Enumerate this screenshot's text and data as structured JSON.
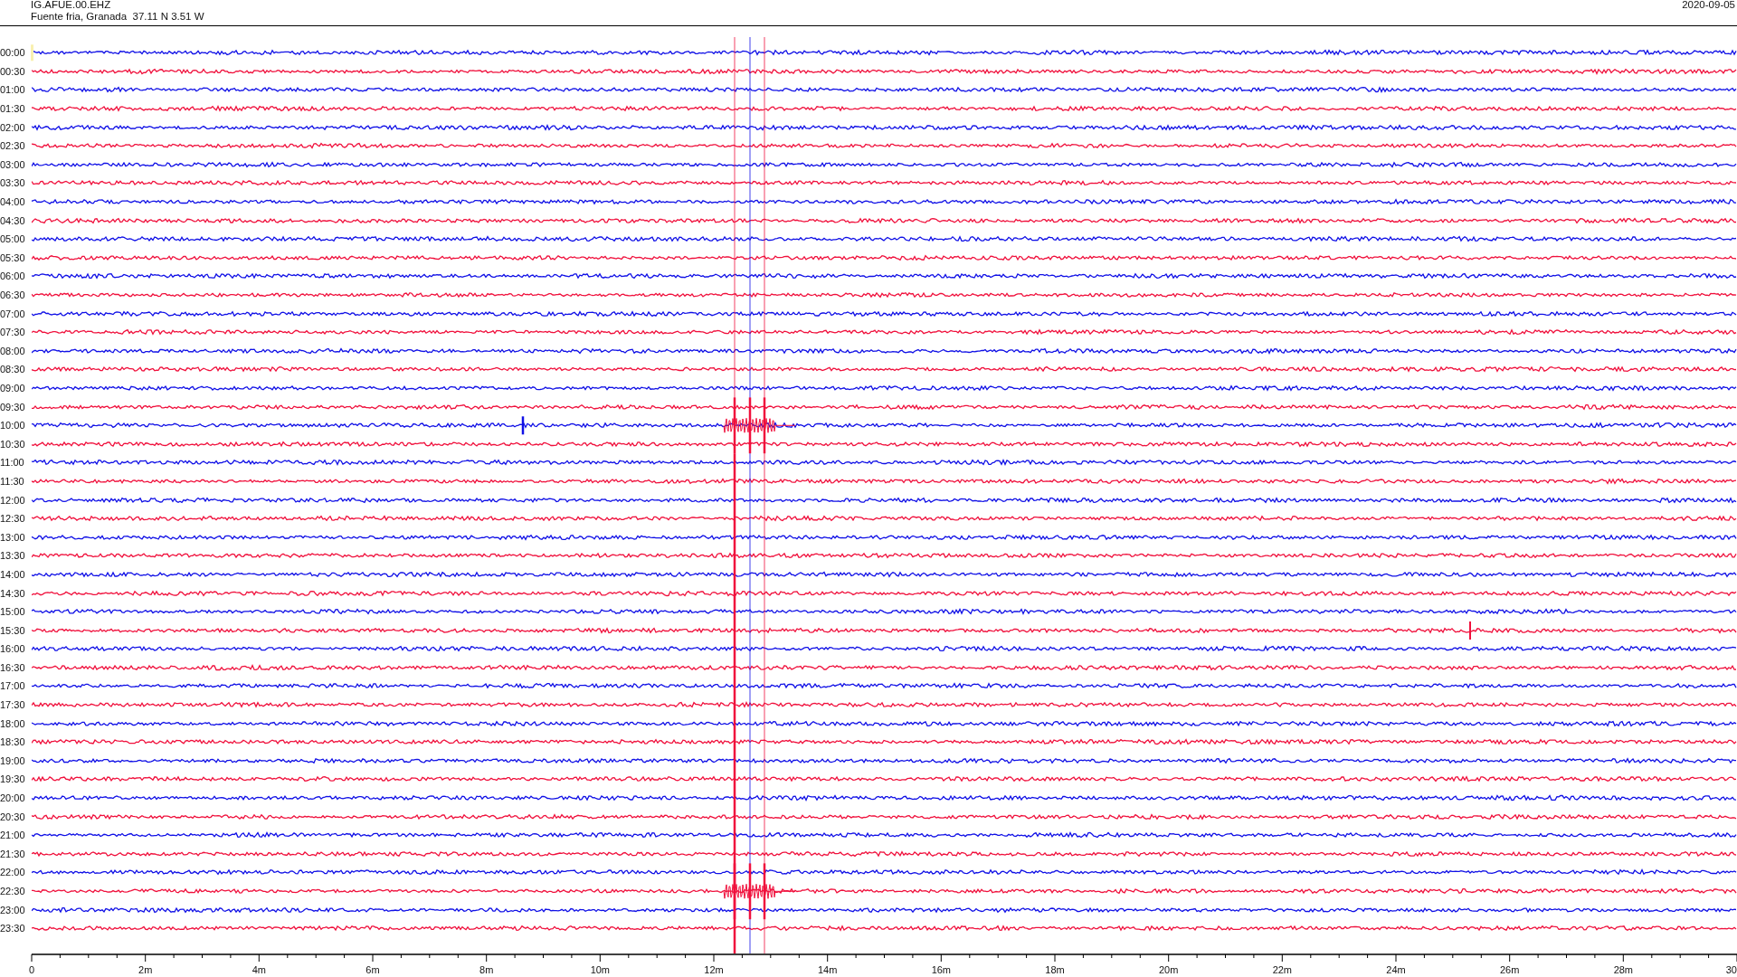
{
  "header": {
    "station": "IG.AFUE.00.EHZ",
    "location": "Fuente fria, Granada  37.11 N 3.51 W",
    "date": "2020-09-05"
  },
  "rows": [
    {
      "time": "00:00",
      "color": "#1010e6"
    },
    {
      "time": "00:30",
      "color": "#f0103c"
    },
    {
      "time": "01:00",
      "color": "#1010e6"
    },
    {
      "time": "01:30",
      "color": "#f0103c"
    },
    {
      "time": "02:00",
      "color": "#1010e6"
    },
    {
      "time": "02:30",
      "color": "#f0103c"
    },
    {
      "time": "03:00",
      "color": "#1010e6"
    },
    {
      "time": "03:30",
      "color": "#f0103c"
    },
    {
      "time": "04:00",
      "color": "#1010e6"
    },
    {
      "time": "04:30",
      "color": "#f0103c"
    },
    {
      "time": "05:00",
      "color": "#1010e6"
    },
    {
      "time": "05:30",
      "color": "#f0103c"
    },
    {
      "time": "06:00",
      "color": "#1010e6"
    },
    {
      "time": "06:30",
      "color": "#f0103c"
    },
    {
      "time": "07:00",
      "color": "#1010e6"
    },
    {
      "time": "07:30",
      "color": "#f0103c"
    },
    {
      "time": "08:00",
      "color": "#1010e6"
    },
    {
      "time": "08:30",
      "color": "#f0103c"
    },
    {
      "time": "09:00",
      "color": "#1010e6"
    },
    {
      "time": "09:30",
      "color": "#f0103c"
    },
    {
      "time": "10:00",
      "color": "#1010e6"
    },
    {
      "time": "10:30",
      "color": "#f0103c"
    },
    {
      "time": "11:00",
      "color": "#1010e6"
    },
    {
      "time": "11:30",
      "color": "#f0103c"
    },
    {
      "time": "12:00",
      "color": "#1010e6"
    },
    {
      "time": "12:30",
      "color": "#f0103c"
    },
    {
      "time": "13:00",
      "color": "#1010e6"
    },
    {
      "time": "13:30",
      "color": "#f0103c"
    },
    {
      "time": "14:00",
      "color": "#1010e6"
    },
    {
      "time": "14:30",
      "color": "#f0103c"
    },
    {
      "time": "15:00",
      "color": "#1010e6"
    },
    {
      "time": "15:30",
      "color": "#f0103c"
    },
    {
      "time": "16:00",
      "color": "#1010e6"
    },
    {
      "time": "16:30",
      "color": "#f0103c"
    },
    {
      "time": "17:00",
      "color": "#1010e6"
    },
    {
      "time": "17:30",
      "color": "#f0103c"
    },
    {
      "time": "18:00",
      "color": "#1010e6"
    },
    {
      "time": "18:30",
      "color": "#f0103c"
    },
    {
      "time": "19:00",
      "color": "#1010e6"
    },
    {
      "time": "19:30",
      "color": "#f0103c"
    },
    {
      "time": "20:00",
      "color": "#1010e6"
    },
    {
      "time": "20:30",
      "color": "#f0103c"
    },
    {
      "time": "21:00",
      "color": "#1010e6"
    },
    {
      "time": "21:30",
      "color": "#f0103c"
    },
    {
      "time": "22:00",
      "color": "#1010e6"
    },
    {
      "time": "22:30",
      "color": "#f0103c"
    },
    {
      "time": "23:00",
      "color": "#1010e6"
    },
    {
      "time": "23:30",
      "color": "#f0103c"
    }
  ],
  "x_axis": {
    "ticks": [
      "0",
      "2m",
      "4m",
      "6m",
      "8m",
      "10m",
      "12m",
      "14m",
      "16m",
      "18m",
      "20m",
      "22m",
      "24m",
      "26m",
      "28m",
      "30"
    ]
  }
}
